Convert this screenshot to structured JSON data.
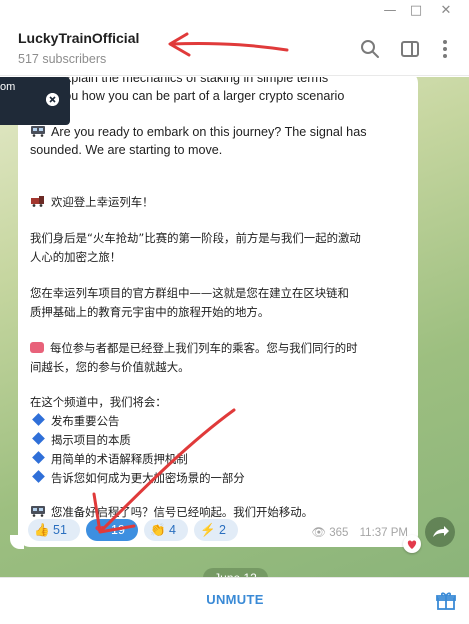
{
  "channel": {
    "title": "LuckyTrainOfficial",
    "subtitle": "517 subscribers"
  },
  "overlay": {
    "text": "om"
  },
  "message": {
    "lines_en": [
      "explain the mechanics of staking in simple terms",
      "you how you can be part of a larger crypto scenario",
      "Are you ready to embark on this journey? The signal has",
      "sounded. We are starting to move."
    ],
    "zh_title": "欢迎登上幸运列车！",
    "zh_p1_l1": "我们身后是“火车抢劫”比赛的第一阶段，前方是与我们一起的激动",
    "zh_p1_l2": "人心的加密之旅！",
    "zh_p2_l1": "您在幸运列车项目的官方群组中——这就是您在建立在区块链和",
    "zh_p2_l2": "质押基础上的教育元宇宙中的旅程开始的地方。",
    "zh_p3_l1": "每位参与者都是已经登上我们列车的乘客。您与我们同行的时",
    "zh_p3_l2": "间越长，您的参与价值就越大。",
    "zh_p4": "在这个频道中，我们将会：",
    "zh_bullets": [
      "发布重要公告",
      "揭示项目的本质",
      "用简单的术语解释质押机制",
      "告诉您如何成为更大加密场景的一部分"
    ],
    "zh_last": "您准备好启程了吗？信号已经响起。我们开始移动。"
  },
  "reactions": [
    {
      "icon": "👍",
      "count": "51"
    },
    {
      "icon": "❤",
      "count": "19"
    },
    {
      "icon": "👏",
      "count": "4"
    },
    {
      "icon": "⚡",
      "count": "2"
    }
  ],
  "meta": {
    "views": "365",
    "time": "11:37 PM"
  },
  "date_pill": "June 12",
  "bottom": {
    "unmute_label": "UNMUTE"
  },
  "colors": {
    "accent": "#3a8ad6",
    "reaction_bg": "#e2ecf7",
    "reaction_active": "#3d8fe0",
    "annotation": "#e03a3a"
  }
}
